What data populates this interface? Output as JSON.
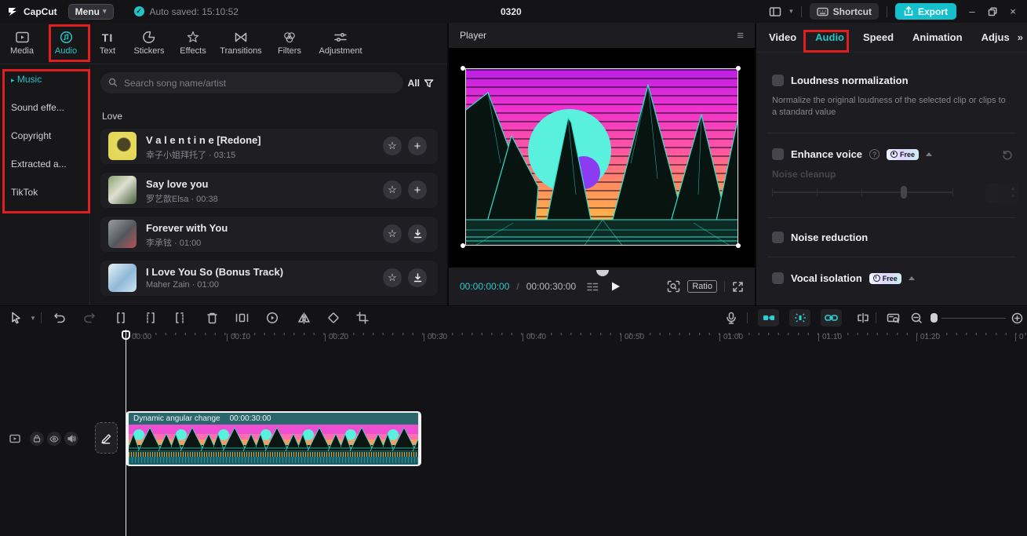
{
  "icons": {
    "check": "✓",
    "chevron_down": "▾",
    "chevron_up": "▴",
    "arrow_right": "▸",
    "note": "♪",
    "star": "☆",
    "plus": "+",
    "play": "▶",
    "double_chevron": "»",
    "minimize": "–",
    "close": "×",
    "text_tab": "TI",
    "help": "?",
    "hamburger": "≡"
  },
  "colors": {
    "accent": "#23c4c4",
    "annotation_red": "#e01e1e",
    "export_teal": "#13c0cc"
  },
  "titlebar": {
    "app_name": "CapCut",
    "menu_label": "Menu",
    "autosave": "Auto saved: 15:10:52",
    "project_title": "0320",
    "shortcut_label": "Shortcut",
    "export_label": "Export"
  },
  "media_tabs": {
    "items": [
      {
        "label": "Media"
      },
      {
        "label": "Audio"
      },
      {
        "label": "Text"
      },
      {
        "label": "Stickers"
      },
      {
        "label": "Effects"
      },
      {
        "label": "Transitions"
      },
      {
        "label": "Filters"
      },
      {
        "label": "Adjustment"
      }
    ]
  },
  "audio_sidebar": {
    "items": [
      {
        "label": "Music"
      },
      {
        "label": "Sound effe..."
      },
      {
        "label": "Copyright"
      },
      {
        "label": "Extracted a..."
      },
      {
        "label": "TikTok"
      }
    ]
  },
  "music_panel": {
    "search_placeholder": "Search song name/artist",
    "filter_label": "All",
    "section_title": "Love",
    "songs": [
      {
        "title": "V a l e n t i n e [Redone]",
        "meta": "幸子小姐拜托了 · 03:15",
        "action": "add"
      },
      {
        "title": "Say love you",
        "meta": "罗艺歆Elsa · 00:38",
        "action": "add"
      },
      {
        "title": "Forever with You",
        "meta": "李承铉 · 01:00",
        "action": "download"
      },
      {
        "title": "I Love You So (Bonus Track)",
        "meta": "Maher Zain · 01:00",
        "action": "download"
      }
    ]
  },
  "player": {
    "title": "Player",
    "current_time": "00:00:00:00",
    "duration": "00:00:30:00",
    "ratio_label": "Ratio"
  },
  "right_panel": {
    "tabs": [
      {
        "label": "Video"
      },
      {
        "label": "Audio"
      },
      {
        "label": "Speed"
      },
      {
        "label": "Animation"
      },
      {
        "label": "Adjus"
      }
    ],
    "loudness_label": "Loudness normalization",
    "loudness_desc": "Normalize the original loudness of the selected clip or clips to a standard value",
    "enhance_label": "Enhance voice",
    "free_badge": "Free",
    "noise_cleanup_label": "Noise cleanup",
    "noise_reduction_label": "Noise reduction",
    "vocal_isolation_label": "Vocal isolation"
  },
  "timeline": {
    "ruler_labels": [
      "00:00",
      "00:10",
      "00:20",
      "00:30",
      "00:40",
      "00:50",
      "01:00",
      "01:10",
      "01:20",
      "0"
    ],
    "clip_name": "Dynamic angular change",
    "clip_duration": "00:00:30:00"
  }
}
